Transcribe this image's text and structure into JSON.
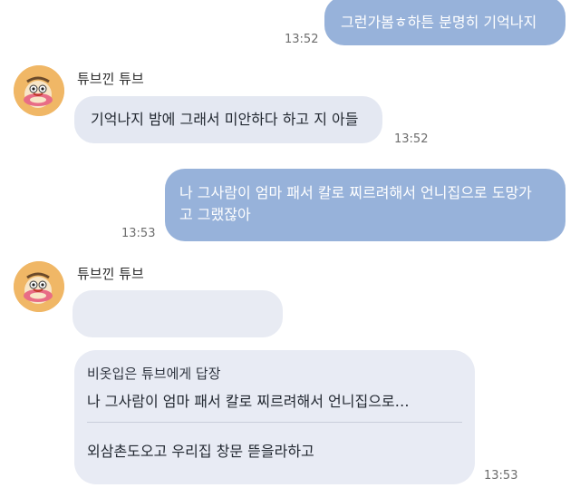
{
  "messages": [
    {
      "text": "그런가봄ㅎ하튼 분명히 기억나지",
      "time": "13:52"
    },
    {
      "sender": "튜브낀 튜브",
      "text": "기억나지 밤에 그래서 미안하다 하고 지 아들",
      "time": "13:52"
    },
    {
      "line1": "나 그사람이 엄마 패서 칼로 찌르려해서 언니집으로 도망가",
      "line2": "고 그랬잖아",
      "time": "13:53"
    },
    {
      "sender": "튜브낀 튜브",
      "text": ""
    },
    {
      "reply_header": "비옷입은 튜브에게 답장",
      "reply_quote": "나 그사람이 엄마 패서 칼로 찌르려해서 언니집으로…",
      "text": "외삼촌도오고 우리집 창문 뜯을라하고",
      "time": "13:53"
    }
  ],
  "colors": {
    "outgoing": "#97b2da",
    "incoming": "#e4e8f2",
    "avatar": "#f0b766"
  },
  "icons": {
    "avatar": "tube-character-avatar"
  }
}
